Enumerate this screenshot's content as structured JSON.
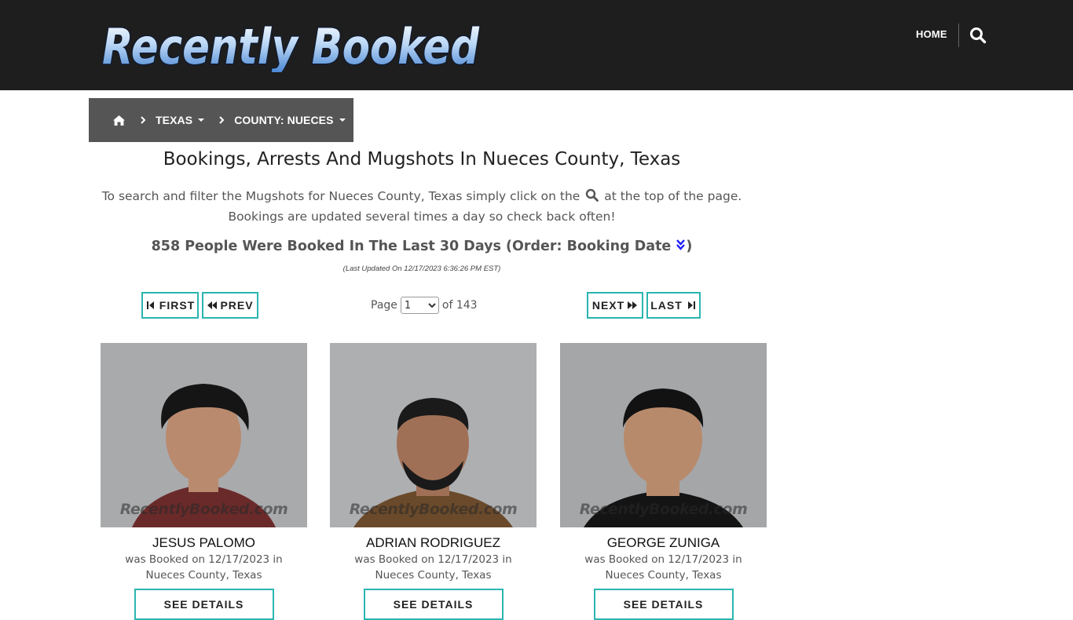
{
  "header": {
    "logo_text": "Recently Booked",
    "nav_home": "HOME",
    "search_icon": "search-icon"
  },
  "breadcrumb": {
    "home_icon": "home-icon",
    "state": "TEXAS",
    "county": "COUNTY: NUECES"
  },
  "main": {
    "title": "Bookings, Arrests And Mugshots In Nueces County, Texas",
    "intro_before": "To search and filter the Mugshots for Nueces County, Texas simply click on the",
    "intro_after": "at the top of the page. Bookings are updated several times a day so check back often!",
    "count_text": "858 People Were Booked In The Last 30 Days (Order: Booking Date",
    "count_close": ")",
    "updated": "(Last Updated On 12/17/2023 6:36:26 PM EST)"
  },
  "pager": {
    "first": "FIRST",
    "prev": "PREV",
    "next": "NEXT",
    "last": "LAST",
    "page_label": "Page",
    "page_selected": "1",
    "of_label": "of 143"
  },
  "watermark": "RecentlyBooked.com",
  "details_label": "SEE DETAILS",
  "bookings": [
    {
      "name": "JESUS PALOMO",
      "info": "was Booked on 12/17/2023 in Nueces County, Texas",
      "shirt": "#6b2a2a",
      "skin": "#b98a6e",
      "hair": "#151515"
    },
    {
      "name": "ADRIAN RODRIGUEZ",
      "info": "was Booked on 12/17/2023 in Nueces County, Texas",
      "shirt": "#6a4a2a",
      "skin": "#a07056",
      "hair": "#1a1a1a"
    },
    {
      "name": "GEORGE ZUNIGA",
      "info": "was Booked on 12/17/2023 in Nueces County, Texas",
      "shirt": "#141414",
      "skin": "#b88a6c",
      "hair": "#121212"
    }
  ],
  "colors": {
    "header_bg": "#1e1e1e",
    "breadcrumb_bg": "#555555",
    "accent_teal": "#2bb5b0",
    "order_icon": "#1a1aff"
  }
}
